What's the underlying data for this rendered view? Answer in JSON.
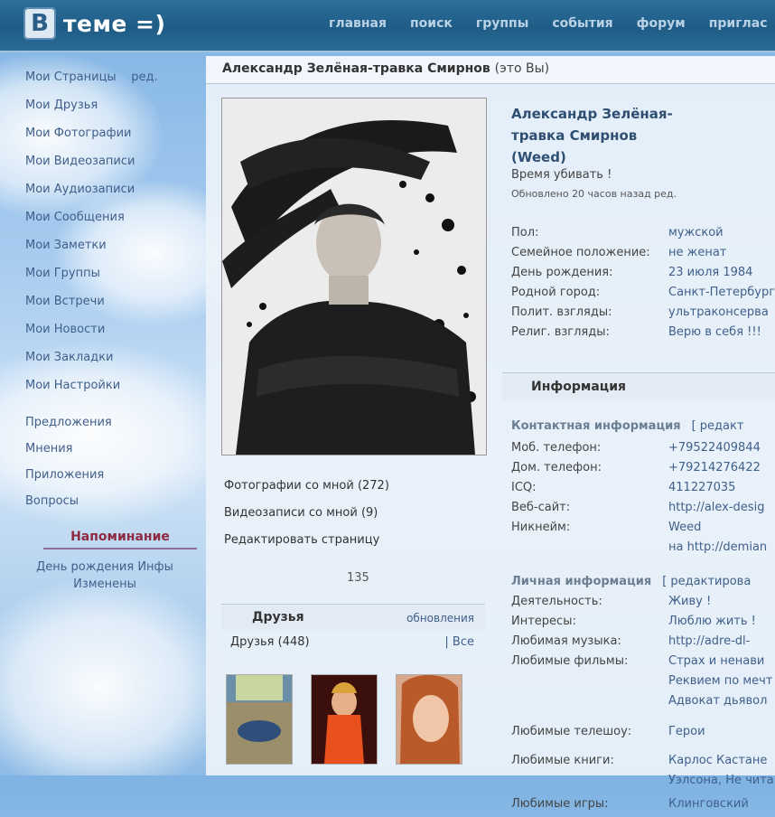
{
  "logo": {
    "letter": "B",
    "text": "теме =)"
  },
  "topnav": [
    "главная",
    "поиск",
    "группы",
    "события",
    "форум",
    "приглас"
  ],
  "sidebar": {
    "items": [
      "Мои Страницы",
      "Мои Друзья",
      "Мои Фотографии",
      "Мои Видеозаписи",
      "Мои Аудиозаписи",
      "Мои Сообщения",
      "Мои Заметки",
      "Мои Группы",
      "Мои Встречи",
      "Мои Новости",
      "Мои Закладки",
      "Мои Настройки"
    ],
    "first_item_suffix": "ред.",
    "extra": [
      "Предложения",
      "Мнения",
      "Приложения",
      "Вопросы"
    ],
    "reminder_title": "Напоминание",
    "reminder_text": "День рождения Инфы\nИзменены"
  },
  "profile": {
    "header_name": "Александр Зелёная-травка Смирнов",
    "header_you": "(это Вы)",
    "name": "Александр Зелёная-травка Смирнов (Weed)",
    "status": "Время убивать !",
    "updated": "Обновлено 20 часов назад ред.",
    "basic": [
      {
        "label": "Пол:",
        "value": "мужской"
      },
      {
        "label": "Семейное положение:",
        "value": "не женат"
      },
      {
        "label": "День рождения:",
        "value": "23 июля 1984"
      },
      {
        "label": "Родной город:",
        "value": "Санкт-Петербург"
      },
      {
        "label": "Полит. взгляды:",
        "value": "ультраконсерва"
      },
      {
        "label": "Религ. взгляды:",
        "value": "Верю в себя !!!"
      }
    ],
    "info_header": "Информация",
    "contact_header": "Контактная информация",
    "contact_edit": "[ редакт",
    "contact": [
      {
        "label": "Моб. телефон:",
        "value": "+79522409844"
      },
      {
        "label": "Дом. телефон:",
        "value": "+79214276422"
      },
      {
        "label": "ICQ:",
        "value": "411227035"
      },
      {
        "label": "Веб-сайт:",
        "value": "http://alex-desig"
      },
      {
        "label": "Никнейм:",
        "value": "Weed"
      },
      {
        "label": "",
        "value": "на http://demian"
      }
    ],
    "personal_header": "Личная информация",
    "personal_edit": "[ редактирова",
    "personal": [
      {
        "label": "Деятельность:",
        "value": "Живу !"
      },
      {
        "label": "Интересы:",
        "value": "Люблю жить !"
      },
      {
        "label": "Любимая музыка:",
        "value": "http://adre-dl-"
      },
      {
        "label": "Любимые фильмы:",
        "value": "Страх и ненави"
      },
      {
        "label": "",
        "value": "Реквием по мечт"
      },
      {
        "label": "",
        "value": "Адвокат дьявол"
      },
      {
        "label": "Любимые телешоу:",
        "value": "Герои"
      },
      {
        "label": "Любимые книги:",
        "value": "Карлос Кастане"
      },
      {
        "label": "",
        "value": "Уэлсона, Не чита"
      },
      {
        "label": "Любимые игры:",
        "value": "Клинговский"
      }
    ]
  },
  "left": {
    "photos_with_me": "Фотографии со мной (272)",
    "videos_with_me": "Видеозаписи со мной (9)",
    "edit_page": "Редактировать страницу",
    "counter": "135",
    "friends_title": "Друзья",
    "friends_update": "обновления",
    "friends_count": "Друзья (448)",
    "friends_all": "| Все"
  },
  "colors": {
    "topbar": "#1f5c86",
    "link": "#3f5f8a",
    "reminder": "#8e2a42"
  }
}
